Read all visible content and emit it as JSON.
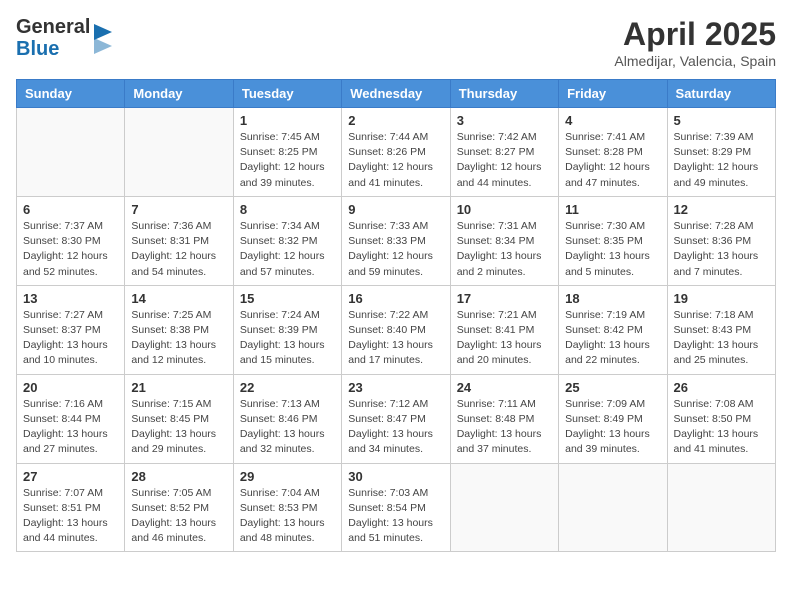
{
  "header": {
    "logo_general": "General",
    "logo_blue": "Blue",
    "month_title": "April 2025",
    "location": "Almedijar, Valencia, Spain"
  },
  "weekdays": [
    "Sunday",
    "Monday",
    "Tuesday",
    "Wednesday",
    "Thursday",
    "Friday",
    "Saturday"
  ],
  "weeks": [
    [
      {
        "day": "",
        "info": ""
      },
      {
        "day": "",
        "info": ""
      },
      {
        "day": "1",
        "info": "Sunrise: 7:45 AM\nSunset: 8:25 PM\nDaylight: 12 hours and 39 minutes."
      },
      {
        "day": "2",
        "info": "Sunrise: 7:44 AM\nSunset: 8:26 PM\nDaylight: 12 hours and 41 minutes."
      },
      {
        "day": "3",
        "info": "Sunrise: 7:42 AM\nSunset: 8:27 PM\nDaylight: 12 hours and 44 minutes."
      },
      {
        "day": "4",
        "info": "Sunrise: 7:41 AM\nSunset: 8:28 PM\nDaylight: 12 hours and 47 minutes."
      },
      {
        "day": "5",
        "info": "Sunrise: 7:39 AM\nSunset: 8:29 PM\nDaylight: 12 hours and 49 minutes."
      }
    ],
    [
      {
        "day": "6",
        "info": "Sunrise: 7:37 AM\nSunset: 8:30 PM\nDaylight: 12 hours and 52 minutes."
      },
      {
        "day": "7",
        "info": "Sunrise: 7:36 AM\nSunset: 8:31 PM\nDaylight: 12 hours and 54 minutes."
      },
      {
        "day": "8",
        "info": "Sunrise: 7:34 AM\nSunset: 8:32 PM\nDaylight: 12 hours and 57 minutes."
      },
      {
        "day": "9",
        "info": "Sunrise: 7:33 AM\nSunset: 8:33 PM\nDaylight: 12 hours and 59 minutes."
      },
      {
        "day": "10",
        "info": "Sunrise: 7:31 AM\nSunset: 8:34 PM\nDaylight: 13 hours and 2 minutes."
      },
      {
        "day": "11",
        "info": "Sunrise: 7:30 AM\nSunset: 8:35 PM\nDaylight: 13 hours and 5 minutes."
      },
      {
        "day": "12",
        "info": "Sunrise: 7:28 AM\nSunset: 8:36 PM\nDaylight: 13 hours and 7 minutes."
      }
    ],
    [
      {
        "day": "13",
        "info": "Sunrise: 7:27 AM\nSunset: 8:37 PM\nDaylight: 13 hours and 10 minutes."
      },
      {
        "day": "14",
        "info": "Sunrise: 7:25 AM\nSunset: 8:38 PM\nDaylight: 13 hours and 12 minutes."
      },
      {
        "day": "15",
        "info": "Sunrise: 7:24 AM\nSunset: 8:39 PM\nDaylight: 13 hours and 15 minutes."
      },
      {
        "day": "16",
        "info": "Sunrise: 7:22 AM\nSunset: 8:40 PM\nDaylight: 13 hours and 17 minutes."
      },
      {
        "day": "17",
        "info": "Sunrise: 7:21 AM\nSunset: 8:41 PM\nDaylight: 13 hours and 20 minutes."
      },
      {
        "day": "18",
        "info": "Sunrise: 7:19 AM\nSunset: 8:42 PM\nDaylight: 13 hours and 22 minutes."
      },
      {
        "day": "19",
        "info": "Sunrise: 7:18 AM\nSunset: 8:43 PM\nDaylight: 13 hours and 25 minutes."
      }
    ],
    [
      {
        "day": "20",
        "info": "Sunrise: 7:16 AM\nSunset: 8:44 PM\nDaylight: 13 hours and 27 minutes."
      },
      {
        "day": "21",
        "info": "Sunrise: 7:15 AM\nSunset: 8:45 PM\nDaylight: 13 hours and 29 minutes."
      },
      {
        "day": "22",
        "info": "Sunrise: 7:13 AM\nSunset: 8:46 PM\nDaylight: 13 hours and 32 minutes."
      },
      {
        "day": "23",
        "info": "Sunrise: 7:12 AM\nSunset: 8:47 PM\nDaylight: 13 hours and 34 minutes."
      },
      {
        "day": "24",
        "info": "Sunrise: 7:11 AM\nSunset: 8:48 PM\nDaylight: 13 hours and 37 minutes."
      },
      {
        "day": "25",
        "info": "Sunrise: 7:09 AM\nSunset: 8:49 PM\nDaylight: 13 hours and 39 minutes."
      },
      {
        "day": "26",
        "info": "Sunrise: 7:08 AM\nSunset: 8:50 PM\nDaylight: 13 hours and 41 minutes."
      }
    ],
    [
      {
        "day": "27",
        "info": "Sunrise: 7:07 AM\nSunset: 8:51 PM\nDaylight: 13 hours and 44 minutes."
      },
      {
        "day": "28",
        "info": "Sunrise: 7:05 AM\nSunset: 8:52 PM\nDaylight: 13 hours and 46 minutes."
      },
      {
        "day": "29",
        "info": "Sunrise: 7:04 AM\nSunset: 8:53 PM\nDaylight: 13 hours and 48 minutes."
      },
      {
        "day": "30",
        "info": "Sunrise: 7:03 AM\nSunset: 8:54 PM\nDaylight: 13 hours and 51 minutes."
      },
      {
        "day": "",
        "info": ""
      },
      {
        "day": "",
        "info": ""
      },
      {
        "day": "",
        "info": ""
      }
    ]
  ]
}
